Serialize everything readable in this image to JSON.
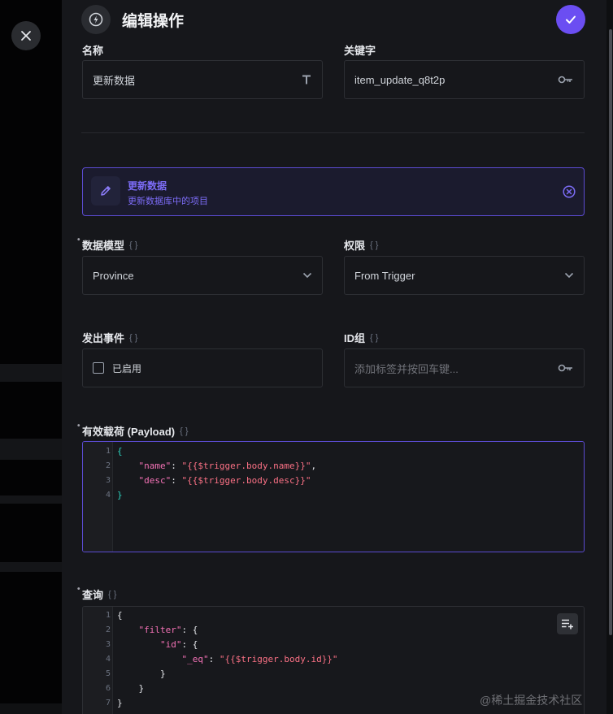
{
  "header": {
    "title": "编辑操作"
  },
  "fields": {
    "name": {
      "label": "名称",
      "value": "更新数据"
    },
    "key": {
      "label": "关键字",
      "value": "item_update_q8t2p"
    },
    "model": {
      "label": "数据模型",
      "value": "Province"
    },
    "permission": {
      "label": "权限",
      "value": "From Trigger"
    },
    "emit": {
      "label": "发出事件",
      "checkbox_label": "已启用"
    },
    "id_group": {
      "label": "ID组",
      "placeholder": "添加标签并按回车键..."
    },
    "payload": {
      "label": "有效载荷 (Payload)"
    },
    "query": {
      "label": "查询"
    }
  },
  "action": {
    "title": "更新数据",
    "subtitle": "更新数据库中的项目"
  },
  "payload_code": {
    "lines": [
      [
        "1",
        [
          [
            "b",
            "{"
          ]
        ]
      ],
      [
        "2",
        [
          [
            "p",
            "    "
          ],
          [
            "k",
            "\"name\""
          ],
          [
            "p",
            ": "
          ],
          [
            "s",
            "\"{{$trigger.body.name}}\""
          ],
          [
            "p",
            ","
          ]
        ]
      ],
      [
        "3",
        [
          [
            "p",
            "    "
          ],
          [
            "k",
            "\"desc\""
          ],
          [
            "p",
            ": "
          ],
          [
            "s",
            "\"{{$trigger.body.desc}}\""
          ]
        ]
      ],
      [
        "4",
        [
          [
            "b",
            "}"
          ]
        ]
      ]
    ]
  },
  "query_code": {
    "lines": [
      [
        "1",
        [
          [
            "p",
            "{"
          ]
        ]
      ],
      [
        "2",
        [
          [
            "p",
            "    "
          ],
          [
            "k",
            "\"filter\""
          ],
          [
            "p",
            ": {"
          ]
        ]
      ],
      [
        "3",
        [
          [
            "p",
            "        "
          ],
          [
            "k",
            "\"id\""
          ],
          [
            "p",
            ": {"
          ]
        ]
      ],
      [
        "4",
        [
          [
            "p",
            "            "
          ],
          [
            "k",
            "\"_eq\""
          ],
          [
            "p",
            ": "
          ],
          [
            "s",
            "\"{{$trigger.body.id}}\""
          ]
        ]
      ],
      [
        "5",
        [
          [
            "p",
            "        }"
          ]
        ]
      ],
      [
        "6",
        [
          [
            "p",
            "    }"
          ]
        ]
      ],
      [
        "7",
        [
          [
            "p",
            "}"
          ]
        ]
      ]
    ]
  },
  "watermark": "@稀土掘金技术社区",
  "colors": {
    "accent": "#6b4ef2",
    "accent_text": "#7c6cf6"
  }
}
